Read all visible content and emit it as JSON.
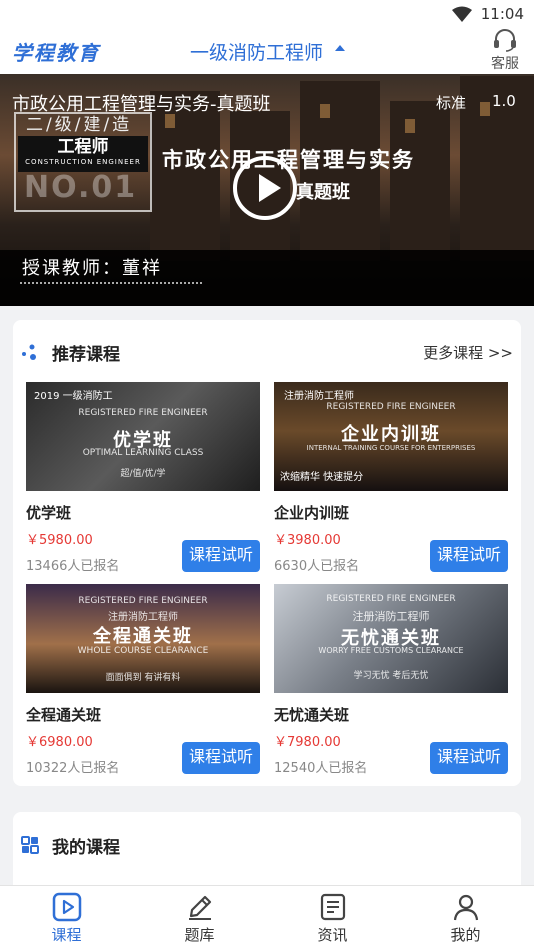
{
  "status_bar": {
    "time": "11:04"
  },
  "header": {
    "logo": "学程教育",
    "title": "一级消防工程师",
    "service_label": "客服"
  },
  "video": {
    "title": "市政公用工程管理与实务-真题班",
    "quality": "标准",
    "speed": "1.0",
    "poster": {
      "left_line1": "二/级/建/造",
      "left_badge": "工程师",
      "left_badge_sub": "CONSTRUCTION ENGINEER",
      "left_no": "NO.01",
      "headline": "市政公用工程管理与实务",
      "subline": "真题班",
      "teacher": "授课教师：董祥"
    }
  },
  "recommended": {
    "title": "推荐课程",
    "more": "更多课程 >>",
    "courses": [
      {
        "name": "优学班",
        "price": "￥5980.00",
        "enrolled": "13466人已报名",
        "button": "课程试听",
        "thumb": {
          "main": "优学班",
          "tag": "2019 一级消防工",
          "eng": "REGISTERED FIRE ENGINEER",
          "sub": "OPTIMAL LEARNING CLASS",
          "foot": "超/值/优/学"
        }
      },
      {
        "name": "企业内训班",
        "price": "￥3980.00",
        "enrolled": "6630人已报名",
        "button": "课程试听",
        "thumb": {
          "main": "企业内训班",
          "tag": "注册消防工程师",
          "eng": "REGISTERED FIRE ENGINEER",
          "sub": "INTERNAL TRAINING COURSE FOR ENTERPRISES",
          "foot": "浓缩精华  快速提分"
        }
      },
      {
        "name": "全程通关班",
        "price": "￥6980.00",
        "enrolled": "10322人已报名",
        "button": "课程试听",
        "thumb": {
          "main": "全程通关班",
          "tag": "注册消防工程师",
          "eng": "REGISTERED FIRE ENGINEER",
          "sub": "WHOLE COURSE CLEARANCE",
          "foot": "面面俱到  有讲有料"
        }
      },
      {
        "name": "无忧通关班",
        "price": "￥7980.00",
        "enrolled": "12540人已报名",
        "button": "课程试听",
        "thumb": {
          "main": "无忧通关班",
          "tag": "注册消防工程师",
          "eng": "REGISTERED FIRE ENGINEER",
          "sub": "WORRY FREE CUSTOMS CLEARANCE",
          "foot": "学习无忧  考后无忧"
        }
      }
    ]
  },
  "my_courses": {
    "title": "我的课程"
  },
  "tabbar": {
    "items": [
      {
        "label": "课程",
        "icon": "play-icon",
        "active": true
      },
      {
        "label": "题库",
        "icon": "pencil-icon",
        "active": false
      },
      {
        "label": "资讯",
        "icon": "news-icon",
        "active": false
      },
      {
        "label": "我的",
        "icon": "user-icon",
        "active": false
      }
    ]
  },
  "colors": {
    "accent": "#2f6fd6",
    "button": "#2f7fe8",
    "price": "#e53935"
  }
}
